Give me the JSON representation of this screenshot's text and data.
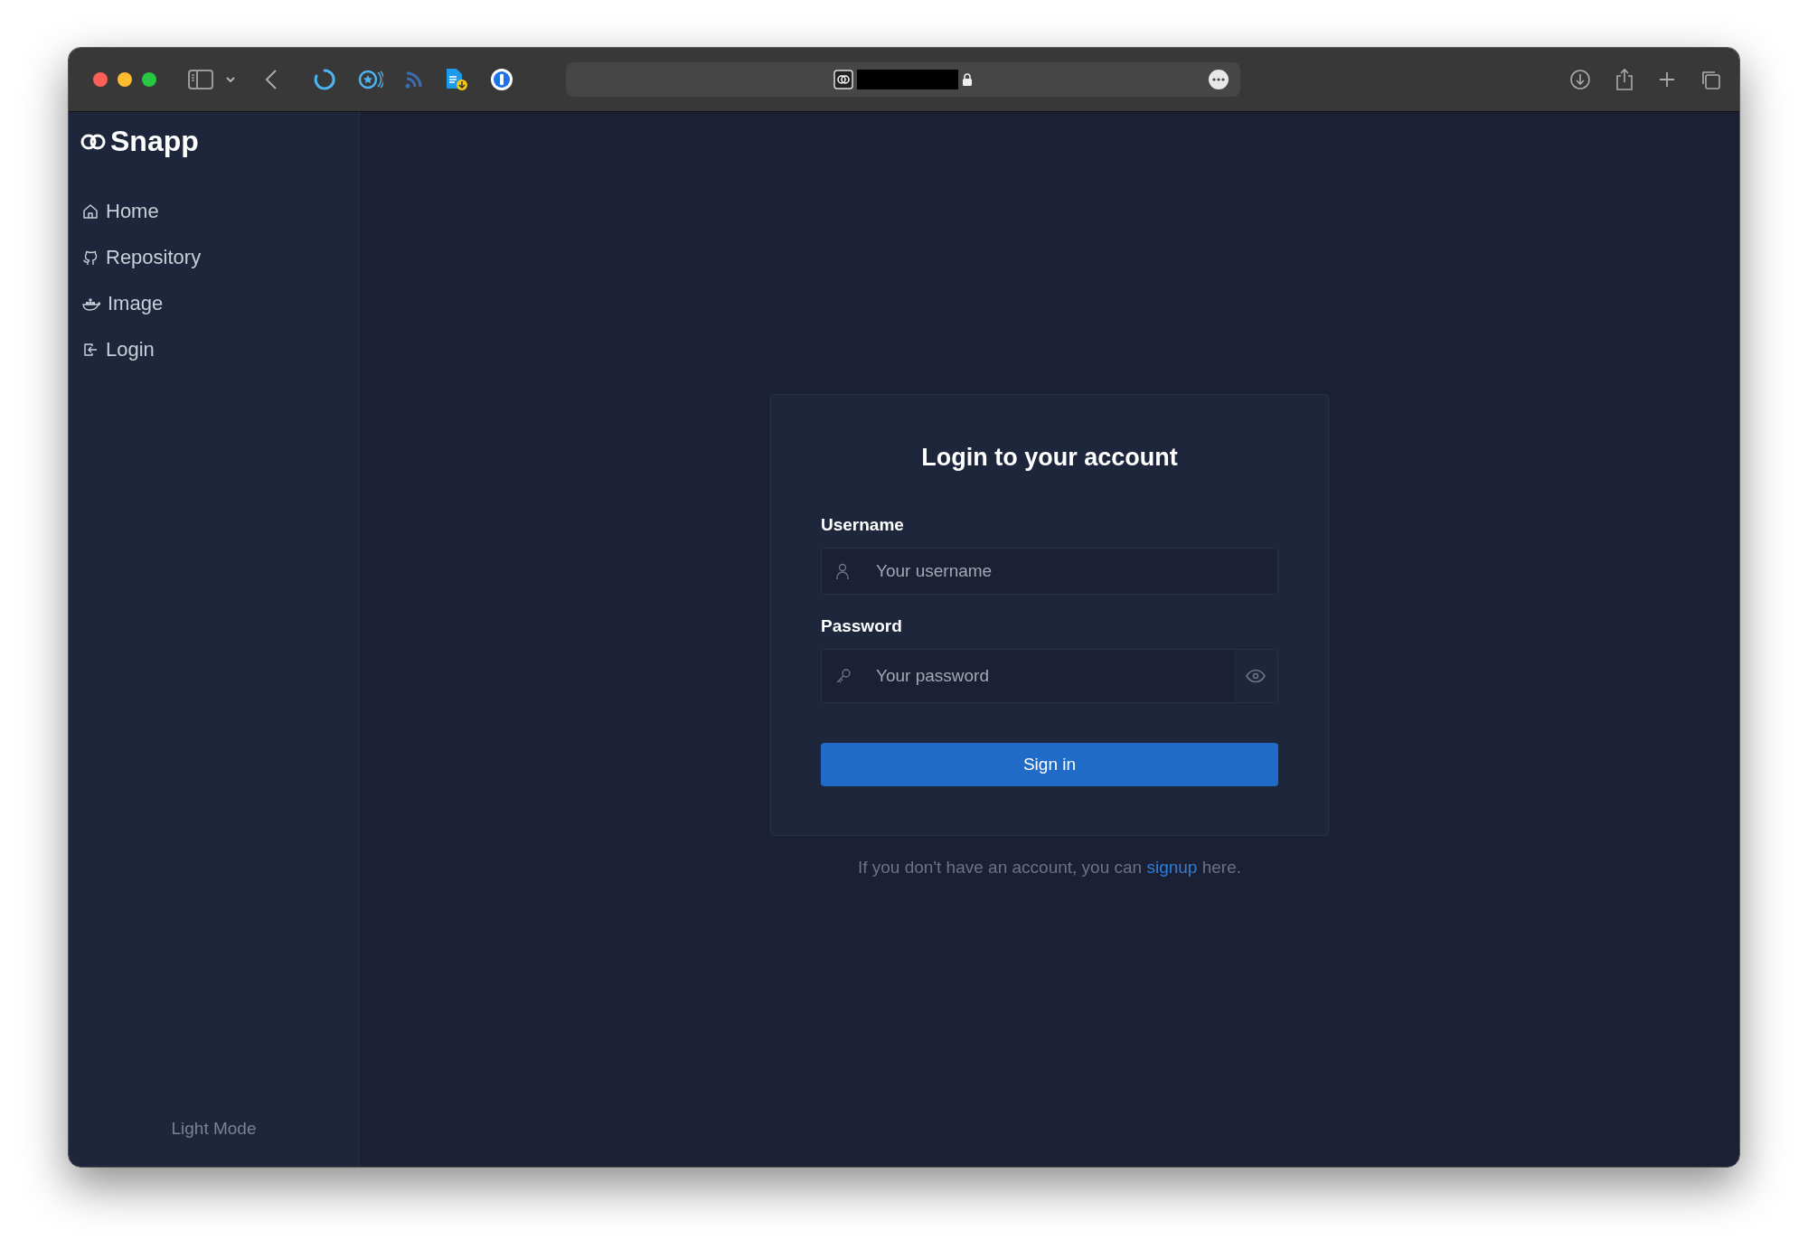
{
  "sidebar": {
    "brand": "Snapp",
    "items": [
      {
        "label": "Home"
      },
      {
        "label": "Repository"
      },
      {
        "label": "Image"
      },
      {
        "label": "Login"
      }
    ],
    "theme_toggle": "Light Mode"
  },
  "login_card": {
    "title": "Login to your account",
    "fields": [
      {
        "kind": "text",
        "label": "Username",
        "placeholder": "Your username"
      },
      {
        "kind": "password",
        "label": "Password",
        "placeholder": "Your password"
      }
    ],
    "submit": "Sign in"
  },
  "signup_note": {
    "before": "If you don't have an account, you can ",
    "link": "signup",
    "after": " here."
  }
}
